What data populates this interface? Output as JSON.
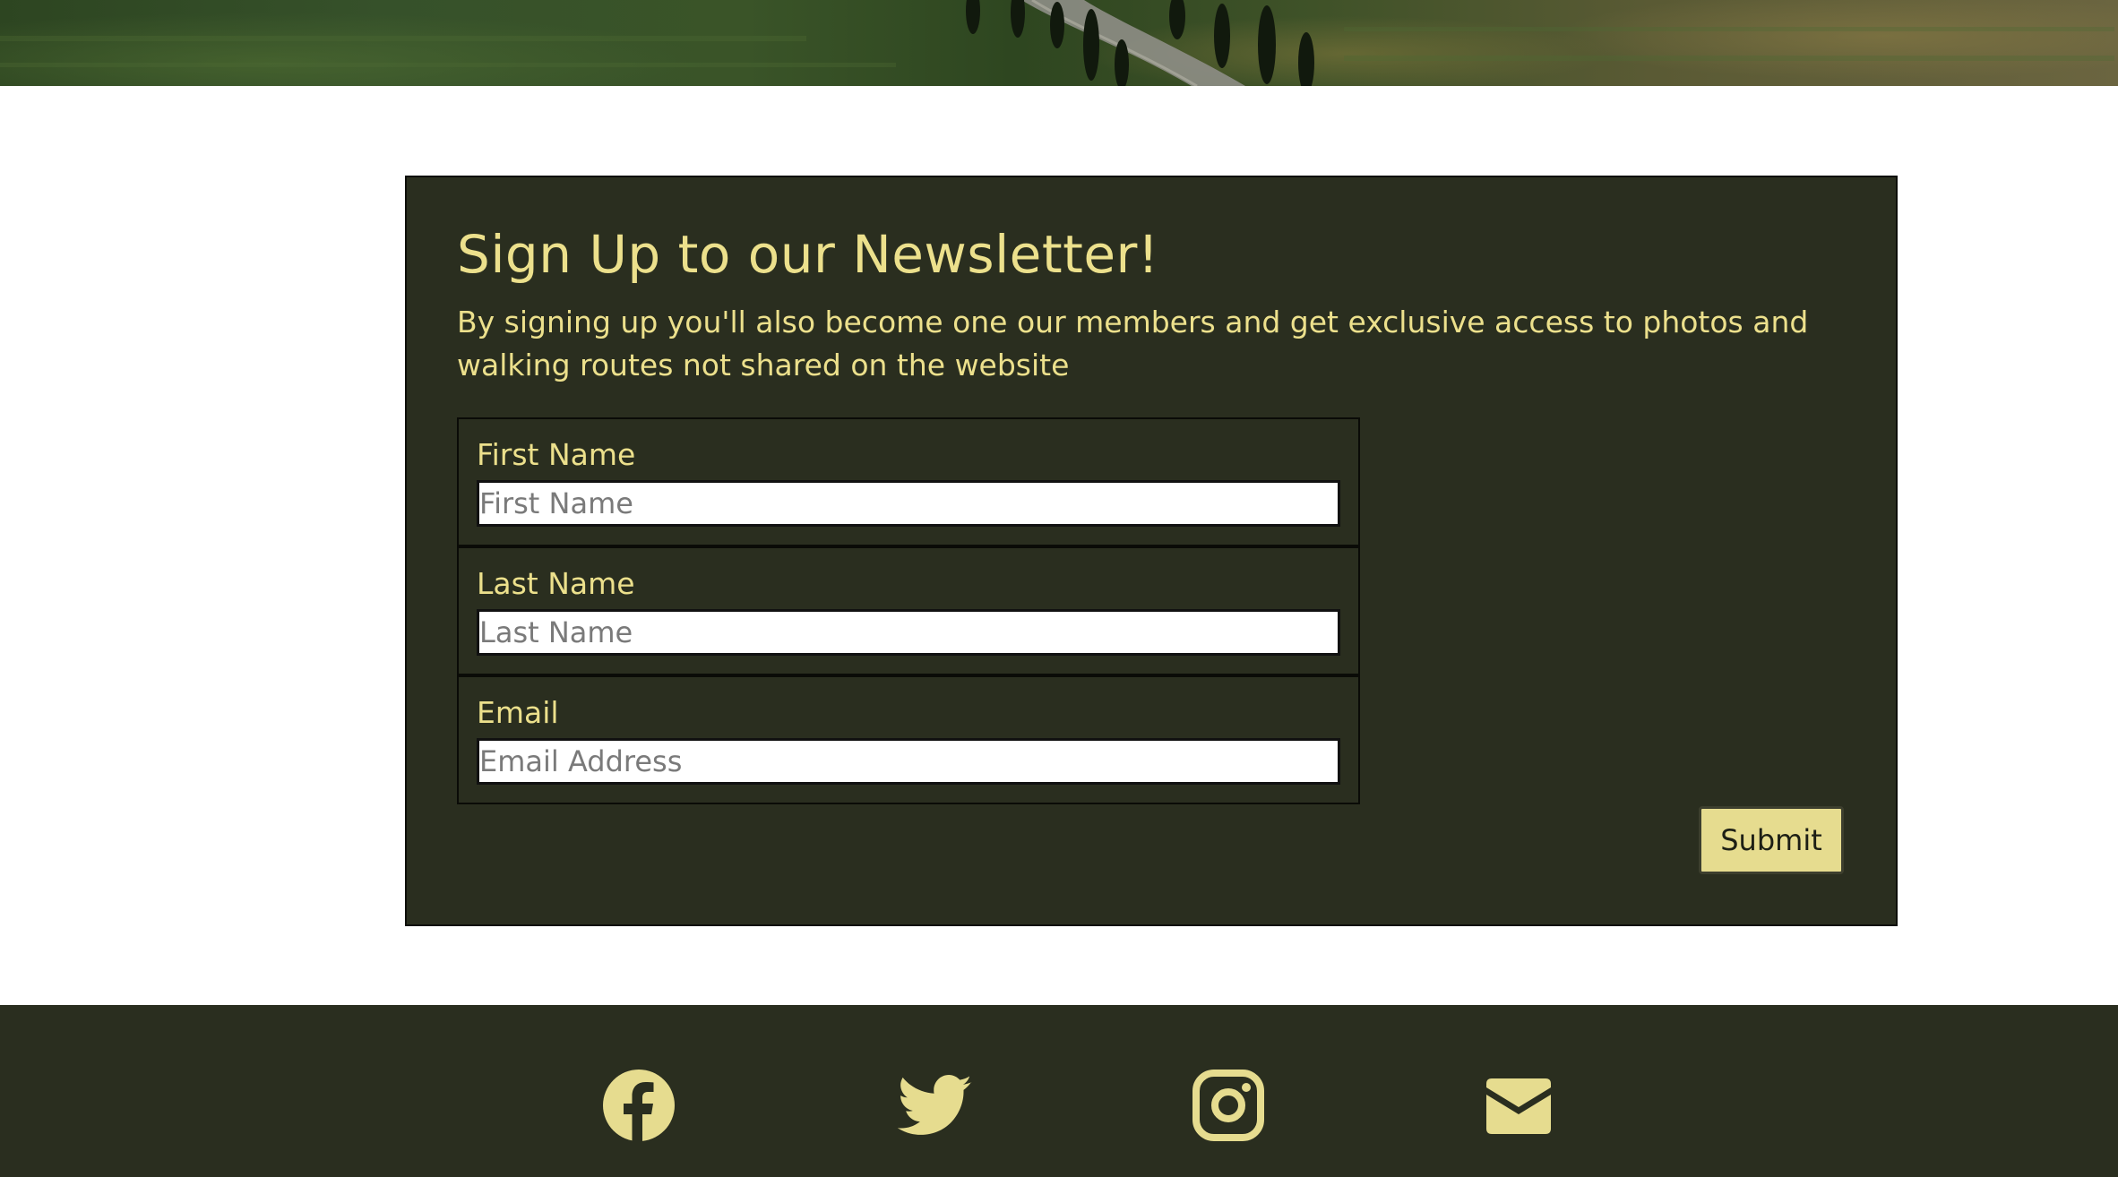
{
  "newsletter": {
    "title": "Sign Up to our Newsletter!",
    "description": "By signing up you'll also become one our members and get exclusive access to photos and walking routes not shared on the website",
    "fields": [
      {
        "label": "First Name",
        "placeholder": "First Name"
      },
      {
        "label": "Last Name",
        "placeholder": "Last Name"
      },
      {
        "label": "Email",
        "placeholder": "Email Address"
      }
    ],
    "submit_label": "Submit"
  },
  "footer": {
    "social_icons": [
      "facebook-icon",
      "twitter-icon",
      "instagram-icon",
      "email-icon"
    ]
  },
  "colors": {
    "panel_background": "#2a2e1f",
    "accent_text": "#ece08c",
    "button_background": "#e6dc8f"
  }
}
